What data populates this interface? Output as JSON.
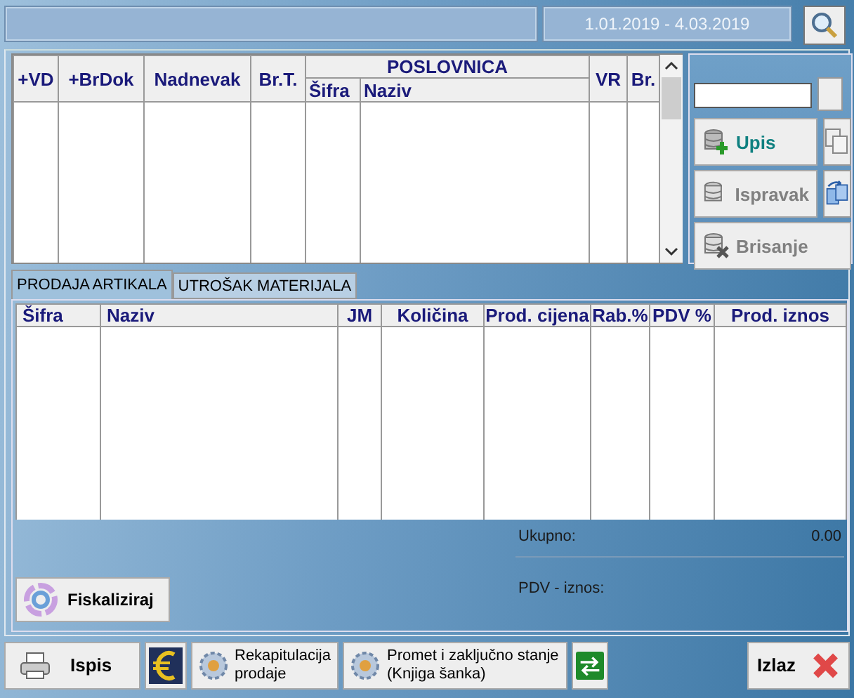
{
  "top_bar": {
    "date_range": "1.01.2019 -  4.03.2019"
  },
  "documents_table": {
    "leading_columns": [
      "+VD",
      "+BrDok",
      "Nadnevak",
      "Br.T."
    ],
    "group": {
      "label": "POSLOVNICA",
      "columns": [
        "Šifra",
        "Naziv"
      ]
    },
    "trailing_columns": [
      "VR",
      "Br."
    ]
  },
  "side_buttons": [
    {
      "label": "Upis",
      "kind": "add",
      "disabled": false
    },
    {
      "label": "Ispravak",
      "kind": "edit",
      "disabled": true
    },
    {
      "label": "Brisanje",
      "kind": "delete",
      "disabled": true
    }
  ],
  "tabs": [
    {
      "label": "PRODAJA ARTIKALA",
      "selected": true
    },
    {
      "label": "UTROŠAK MATERIJALA",
      "selected": false
    }
  ],
  "items_table": {
    "columns": [
      "Šifra",
      "Naziv",
      "JM",
      "Količina",
      "Prod. cijena",
      "Rab.%",
      "PDV %",
      "Prod. iznos"
    ]
  },
  "totals": [
    {
      "label": "Ukupno:",
      "value": "0.00"
    },
    {
      "label": "PDV - iznos:"
    }
  ],
  "fiscal_button": "Fiskaliziraj",
  "bottom_bar": [
    {
      "kind": "print",
      "label": "Ispis"
    },
    {
      "kind": "euro"
    },
    {
      "kind": "report",
      "label": "Rekapitulacija\nprodaje"
    },
    {
      "kind": "report",
      "label": "Promet i zaključno stanje\n(Knjiga šanka)"
    },
    {
      "kind": "transfer"
    },
    {
      "kind": "exit",
      "label": "Izlaz"
    }
  ]
}
